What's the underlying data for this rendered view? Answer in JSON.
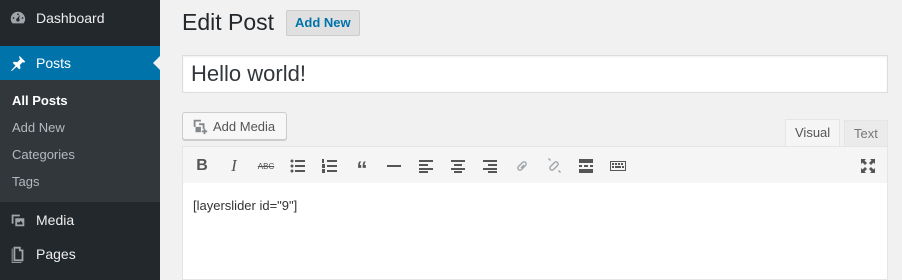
{
  "sidebar": {
    "menu": {
      "dashboard": "Dashboard",
      "posts": "Posts",
      "media": "Media",
      "pages": "Pages"
    },
    "posts_submenu": [
      "All Posts",
      "Add New",
      "Categories",
      "Tags"
    ]
  },
  "header": {
    "title": "Edit Post",
    "add_new": "Add New"
  },
  "post": {
    "title": "Hello world!",
    "content": "[layerslider id=\"9\"]"
  },
  "editor": {
    "add_media": "Add Media",
    "tabs": [
      "Visual",
      "Text"
    ],
    "active_tab": "Visual"
  },
  "colors": {
    "sidebar_bg": "#23282d",
    "active_menu": "#0073aa",
    "link": "#0073aa"
  }
}
